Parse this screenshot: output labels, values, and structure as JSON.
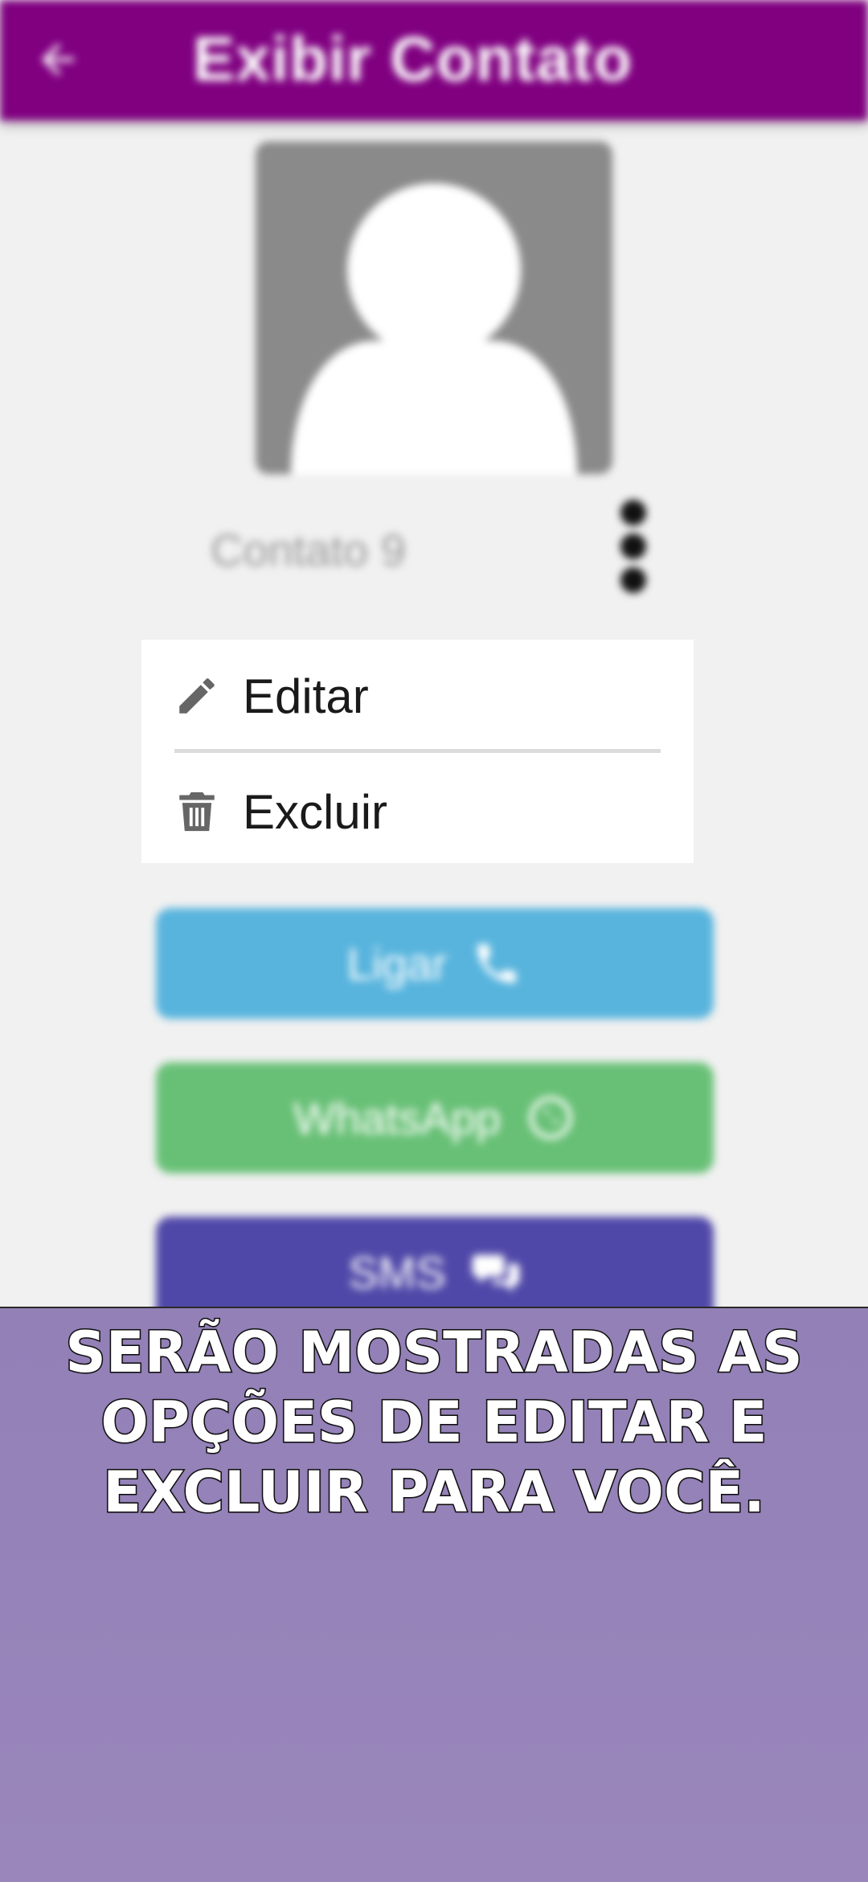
{
  "app_bar": {
    "title": "Exibir Contato",
    "back_icon": "arrow-left-icon",
    "color": "#800080"
  },
  "contact": {
    "name": "Contato 9",
    "avatar_icon": "person-placeholder-icon",
    "more_icon": "more-vertical-icon"
  },
  "menu": {
    "items": [
      {
        "label": "Editar",
        "icon": "pencil-icon"
      },
      {
        "label": "Excluir",
        "icon": "trash-icon"
      }
    ]
  },
  "actions": [
    {
      "label": "Ligar",
      "icon": "phone-icon",
      "color": "#58b4dd"
    },
    {
      "label": "WhatsApp",
      "icon": "whatsapp-icon",
      "color": "#68c076"
    },
    {
      "label": "SMS",
      "icon": "chat-bubbles-icon",
      "color": "#5048a8"
    }
  ],
  "caption": {
    "text": "SERÃO MOSTRADAS AS OPÇÕES DE EDITAR E EXCLUIR PARA VOCÊ."
  }
}
